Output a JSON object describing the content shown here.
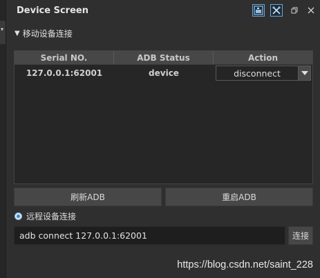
{
  "window": {
    "title": "Device Screen",
    "icons": [
      "screen-icon",
      "tools-icon",
      "restore-icon",
      "close-icon"
    ]
  },
  "section": {
    "label": "移动设备连接"
  },
  "table": {
    "headers": [
      "Serial NO.",
      "ADB Status",
      "Action"
    ],
    "rows": [
      {
        "serial": "127.0.0.1:62001",
        "status": "device",
        "action": "disconnect"
      }
    ]
  },
  "buttons": {
    "refresh_adb": "刷新ADB",
    "restart_adb": "重启ADB",
    "connect": "连接"
  },
  "remote": {
    "label": "远程设备连接",
    "selected": true,
    "command": "adb connect 127.0.0.1:62001"
  },
  "watermark": "https://blog.csdn.net/saint_228",
  "colors": {
    "background": "#2f2f2f",
    "header": "#474747",
    "accent": "#6fa8d8"
  }
}
